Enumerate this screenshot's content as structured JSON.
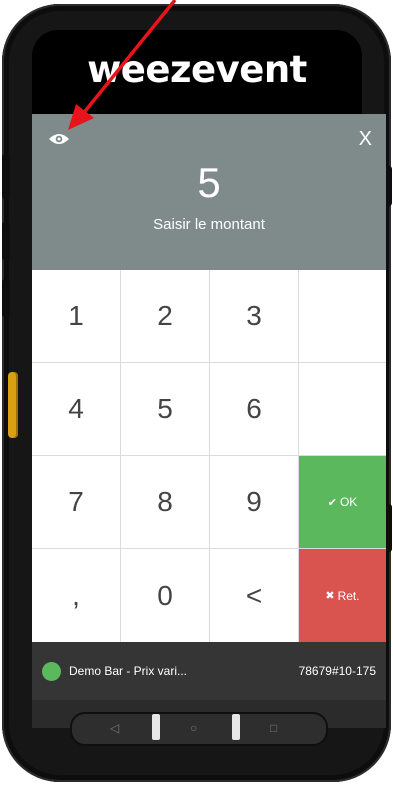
{
  "brand": {
    "name": "weezevent"
  },
  "header": {
    "amount": "5",
    "amount_label": "Saisir le montant",
    "close_label": "X",
    "visibility_icon": "eye-icon"
  },
  "keypad": {
    "keys": [
      "1",
      "2",
      "3",
      "",
      "4",
      "5",
      "6",
      "",
      "7",
      "8",
      "9",
      "OK",
      ",",
      "0",
      "<",
      "Ret."
    ],
    "ok_label": "OK",
    "ret_label": "Ret."
  },
  "footer": {
    "venue": "Demo Bar - Prix vari...",
    "device_id": "78679#10-175",
    "status_color": "#5cb85c"
  },
  "colors": {
    "header_bg": "#7f8b8a",
    "ok_bg": "#5cb85c",
    "ret_bg": "#d9534f",
    "annotation_arrow": "#e8141b"
  }
}
